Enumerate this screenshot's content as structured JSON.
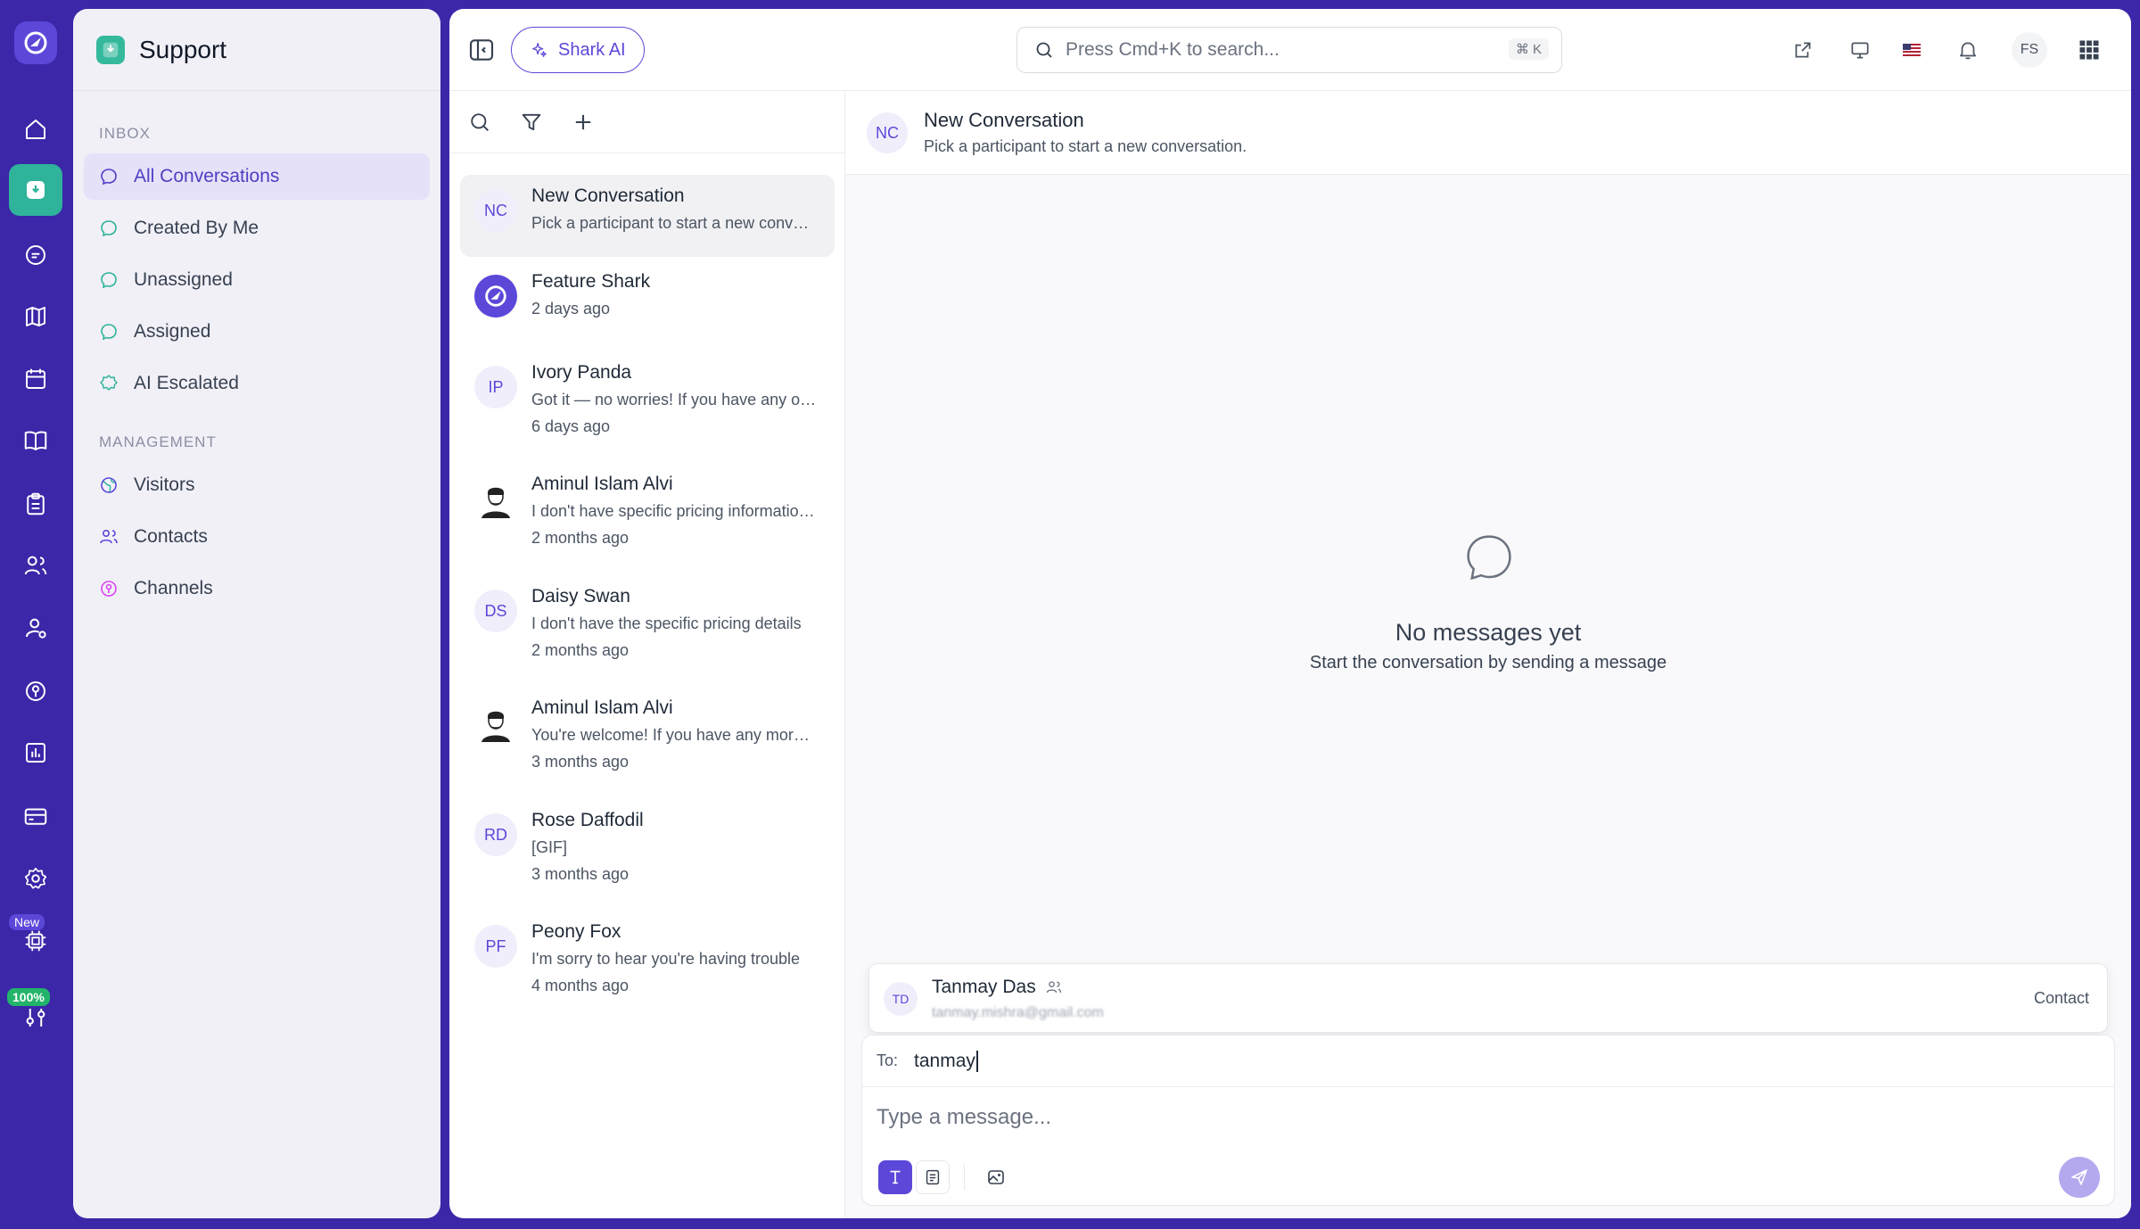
{
  "app": {
    "rail_badges": {
      "new": "New",
      "percent": "100%"
    }
  },
  "panel": {
    "title": "Support",
    "inbox_label": "INBOX",
    "inbox_items": [
      {
        "label": "All Conversations",
        "icon": "chat-bubble-icon",
        "active": true
      },
      {
        "label": "Created By Me",
        "icon": "chat-bubble-icon"
      },
      {
        "label": "Unassigned",
        "icon": "chat-bubble-icon"
      },
      {
        "label": "Assigned",
        "icon": "chat-bubble-icon"
      },
      {
        "label": "AI Escalated",
        "icon": "badge-icon"
      }
    ],
    "management_label": "MANAGEMENT",
    "management_items": [
      {
        "label": "Visitors",
        "icon": "globe-icon"
      },
      {
        "label": "Contacts",
        "icon": "users-icon"
      },
      {
        "label": "Channels",
        "icon": "channel-icon"
      }
    ]
  },
  "topbar": {
    "shark_ai_label": "Shark AI",
    "search_placeholder": "Press Cmd+K to search...",
    "search_shortcut": "⌘ K",
    "user_initials": "FS"
  },
  "conversations": [
    {
      "initials": "NC",
      "name": "New Conversation",
      "preview": "Pick a participant to start a new conversation.",
      "time": ""
    },
    {
      "initials": "",
      "name": "Feature Shark",
      "preview": "",
      "time": "2 days ago"
    },
    {
      "initials": "IP",
      "name": "Ivory Panda",
      "preview": "Got it — no worries! If you have any other questions",
      "time": "6 days ago"
    },
    {
      "initials": "",
      "name": "Aminul Islam Alvi",
      "preview": "I don't have specific pricing information available",
      "time": "2 months ago"
    },
    {
      "initials": "DS",
      "name": "Daisy Swan",
      "preview": "I don't have the specific pricing details",
      "time": "2 months ago"
    },
    {
      "initials": "",
      "name": "Aminul Islam Alvi",
      "preview": "You're welcome! If you have any more questions",
      "time": "3 months ago"
    },
    {
      "initials": "RD",
      "name": "Rose Daffodil",
      "preview": "[GIF]",
      "time": "3 months ago"
    },
    {
      "initials": "PF",
      "name": "Peony Fox",
      "preview": "I'm sorry to hear you're having trouble",
      "time": "4 months ago"
    }
  ],
  "chat": {
    "header_initials": "NC",
    "header_title": "New Conversation",
    "header_sub": "Pick a participant to start a new conversation.",
    "empty_title": "No messages yet",
    "empty_sub": "Start the conversation by sending a message",
    "suggestion": {
      "initials": "TD",
      "name": "Tanmay Das",
      "email": "tanmay.mishra@gmail.com",
      "type": "Contact"
    },
    "to_label": "To:",
    "to_value": "tanmay",
    "message_placeholder": "Type a message..."
  },
  "colors": {
    "accent": "#5b48d9",
    "rail": "#3b27a8",
    "active_rail": "#2fb39a"
  }
}
